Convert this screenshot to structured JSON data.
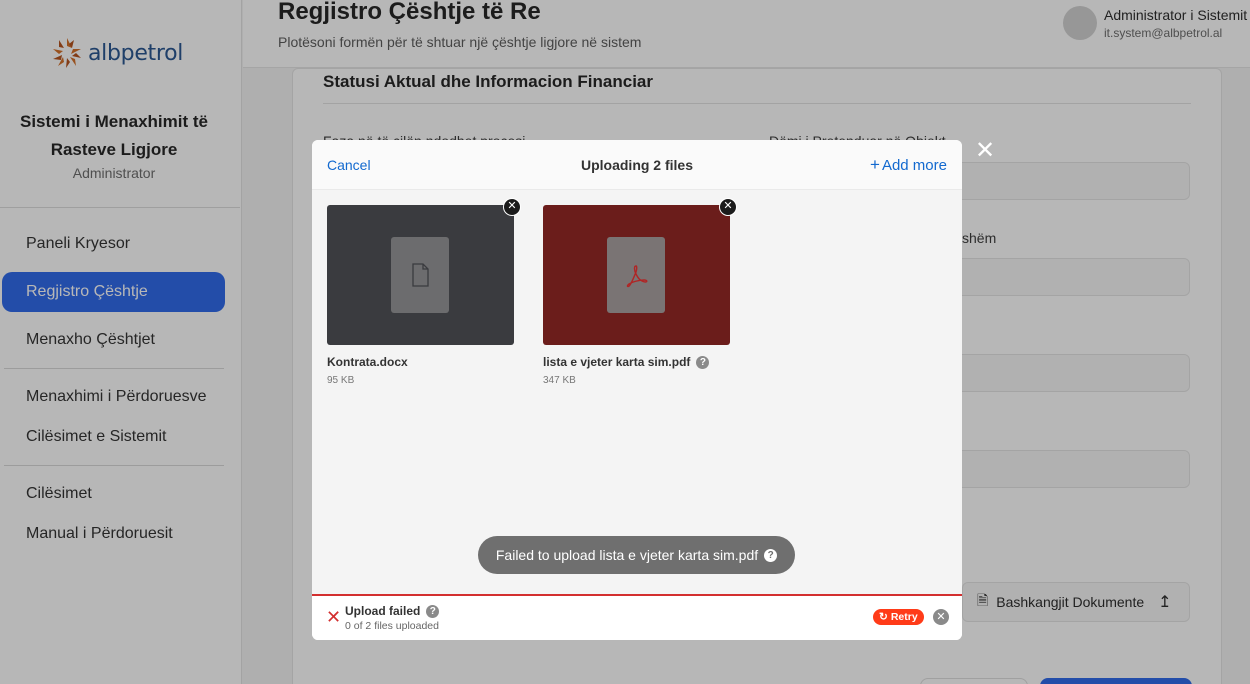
{
  "sidebar": {
    "logo_text": "albpetrol",
    "system_title_line1": "Sistemi i Menaxhimit të",
    "system_title_line2": "Rasteve Ligjore",
    "role": "Administrator",
    "items": [
      {
        "label": "Paneli Kryesor"
      },
      {
        "label": "Regjistro Çështje"
      },
      {
        "label": "Menaxho Çështjet"
      },
      {
        "label": "Menaxhimi i Përdoruesve"
      },
      {
        "label": "Cilësimet e Sistemit"
      },
      {
        "label": "Cilësimet"
      },
      {
        "label": "Manual i Përdoruesit"
      }
    ],
    "active_index": 1,
    "accent_color": "#2563eb"
  },
  "header": {
    "title": "Regjistro Çështje të Re",
    "subtitle": "Plotësoni formën për të shtuar një çështje ligjore në sistem",
    "user_name": "Administrator i Sistemit",
    "user_email": "it.system@albpetrol.al"
  },
  "form": {
    "section_title": "Statusi Aktual dhe Informacion Financiar",
    "label_phase": "Faza në të cilën ndodhet procesi",
    "label_damage": "Dëmi i Pretenduar në Objekt",
    "label_partial": "shëm",
    "attach_label": "Bashkangjit Dokumente"
  },
  "upload_modal": {
    "cancel_label": "Cancel",
    "title": "Uploading 2 files",
    "add_more_label": "Add more",
    "files": [
      {
        "name": "Kontrata.docx",
        "size": "95 KB",
        "type_icon": "file-icon",
        "error": false
      },
      {
        "name": "lista e vjeter karta sim.pdf",
        "size": "347 KB",
        "type_icon": "pdf-icon",
        "error": true
      }
    ],
    "toast_message": "Failed to upload lista e vjeter karta sim.pdf",
    "status_title": "Upload failed",
    "status_sub": "0 of 2 files uploaded",
    "retry_label": "Retry",
    "error_color": "#d32f2f",
    "retry_color": "#ff3b18"
  }
}
